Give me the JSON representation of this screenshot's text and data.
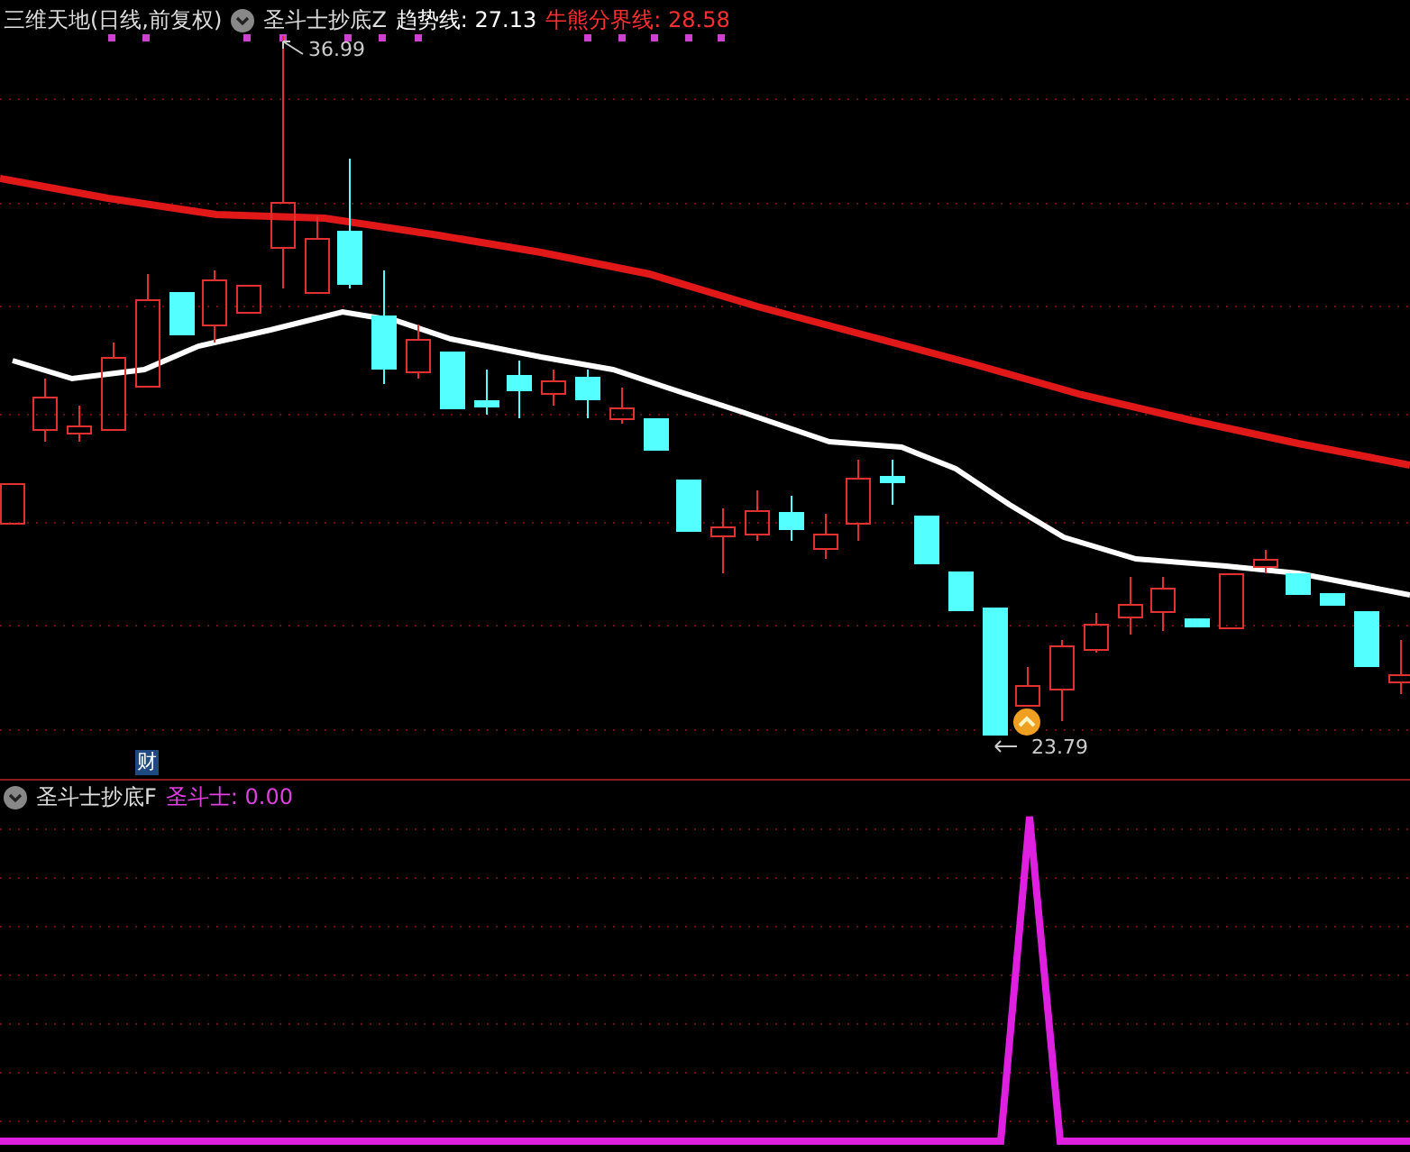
{
  "main_panel": {
    "title": "三维天地(日线,前复权)",
    "indicator": "圣斗士抄底Z",
    "legend": [
      {
        "label": "趋势线: 27.13",
        "color": "#ffffff"
      },
      {
        "label": "牛熊分界线: 28.58",
        "color": "#ff3030"
      }
    ],
    "high_label": "36.99",
    "low_label": "23.79",
    "badge": "财"
  },
  "sub_panel": {
    "indicator": "圣斗士抄底F",
    "legend": [
      {
        "label": "圣斗士: 0.00",
        "color": "#e040e0"
      }
    ]
  }
}
